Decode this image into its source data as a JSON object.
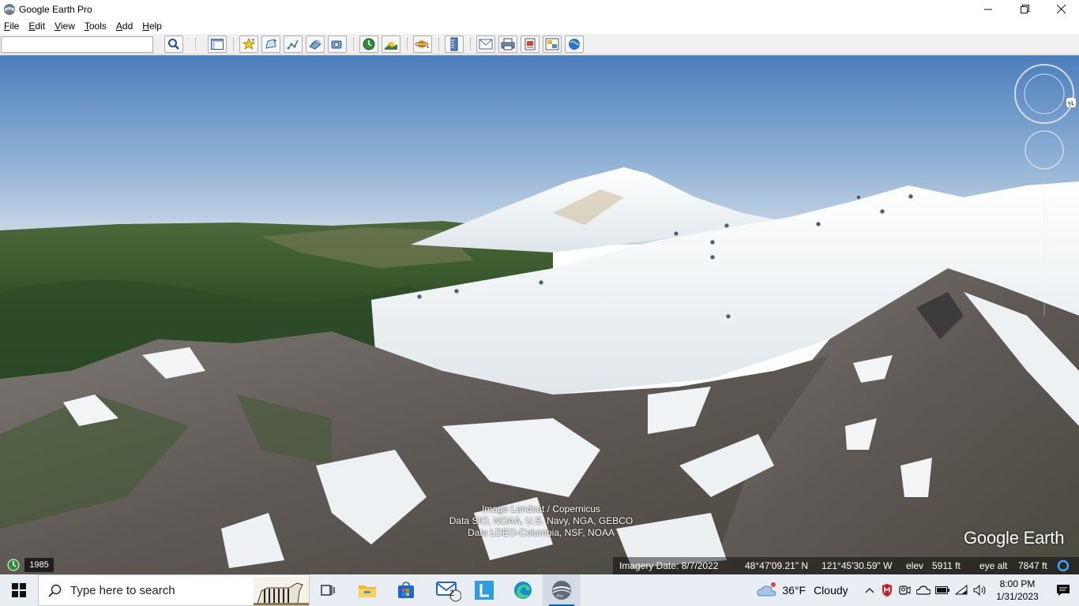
{
  "window": {
    "title": "Google Earth Pro",
    "controls": [
      "minimize",
      "restore",
      "close"
    ]
  },
  "menu": [
    {
      "label": "File",
      "accel": "F"
    },
    {
      "label": "Edit",
      "accel": "E"
    },
    {
      "label": "View",
      "accel": "V"
    },
    {
      "label": "Tools",
      "accel": "T"
    },
    {
      "label": "Add",
      "accel": "A"
    },
    {
      "label": "Help",
      "accel": "H"
    }
  ],
  "toolbar": {
    "search_value": "",
    "buttons": [
      "search-icon",
      "sidebar-toggle-icon",
      "placemark-icon",
      "polygon-icon",
      "path-icon",
      "image-overlay-icon",
      "record-tour-icon",
      "historical-imagery-icon",
      "sunlight-icon",
      "planets-icon",
      "ruler-icon",
      "email-icon",
      "print-icon",
      "save-image-icon",
      "view-in-maps-icon",
      "earth-globe-icon"
    ]
  },
  "earth_view": {
    "attribution": [
      "Image Landsat / Copernicus",
      "Data SIO, NOAA, U.S. Navy, NGA, GEBCO",
      "Data LDEO-Columbia, NSF, NOAA"
    ],
    "logo": "Google Earth",
    "history_year": "1985"
  },
  "status": {
    "imagery_date": "Imagery Date: 8/7/2022",
    "lat": "48°47'09.21\" N",
    "lon": "121°45'30.59\" W",
    "elev_label": "elev",
    "elev_value": "5911 ft",
    "eye_alt_label": "eye alt",
    "eye_alt_value": "7847 ft"
  },
  "taskbar": {
    "search_placeholder": "Type here to search",
    "apps": [
      "task-view-icon",
      "file-explorer-icon",
      "microsoft-store-icon",
      "mail-icon",
      "l-app-icon",
      "edge-icon",
      "google-earth-icon"
    ],
    "mail_badge": "2",
    "weather_temp": "36°F",
    "weather_desc": "Cloudy",
    "time": "8:00 PM",
    "date": "1/31/2023"
  },
  "colors": {
    "sky_top": "#4d80bd",
    "sky_bottom": "#c3d6e6",
    "forest": "#2c4a22",
    "snow": "#eef2f4",
    "rock": "#6f6966",
    "accent": "#0067c0"
  }
}
